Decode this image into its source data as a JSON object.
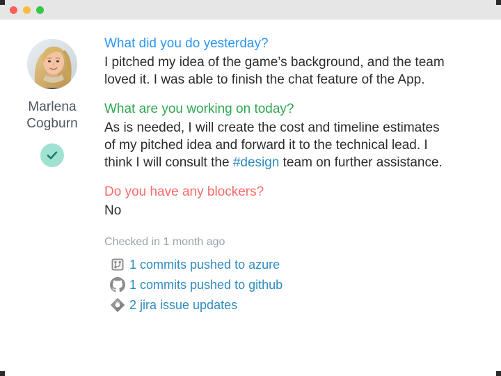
{
  "window": {
    "controls": [
      {
        "name": "close",
        "color": "#fc6058"
      },
      {
        "name": "minimize",
        "color": "#fdbc40"
      },
      {
        "name": "maximize",
        "color": "#34c749"
      }
    ]
  },
  "person": {
    "name_line1": "Marlena",
    "name_line2": "Cogburn",
    "status_icon": "check-icon",
    "status_badge_color": "#9fe2d3",
    "status_check_color": "#1a7a6b",
    "avatar_alt": "Marlena Cogburn avatar"
  },
  "standup": {
    "entries": [
      {
        "question": "What did you do yesterday?",
        "color": "#2b96f1",
        "answer": "I pitched my idea of the game’s background, and the team loved it. I was able to finish the chat feature of the App."
      },
      {
        "question": "What are you working on today?",
        "color": "#2fa84f",
        "answer_part1": "As is needed, I will create the cost and timeline estimates of my pitched idea and forward it to the technical lead. I think I will consult the ",
        "answer_tag": "#design",
        "answer_part2": " team on further assistance."
      },
      {
        "question": "Do you have any blockers?",
        "color": "#fb6a66",
        "answer": "No"
      }
    ],
    "checked_in": "Checked in 1 month ago",
    "activity": [
      {
        "icon": "azure-repos-icon",
        "label": "1 commits pushed to azure"
      },
      {
        "icon": "github-icon",
        "label": "1 commits pushed to github"
      },
      {
        "icon": "jira-icon",
        "label": "2 jira issue updates"
      }
    ]
  },
  "colors": {
    "link": "#2e8bc0",
    "body_text": "#2b2b2b",
    "muted_text": "#9aa3ab",
    "name_text": "#4a5560",
    "titlebar": "#e6e6e6"
  }
}
